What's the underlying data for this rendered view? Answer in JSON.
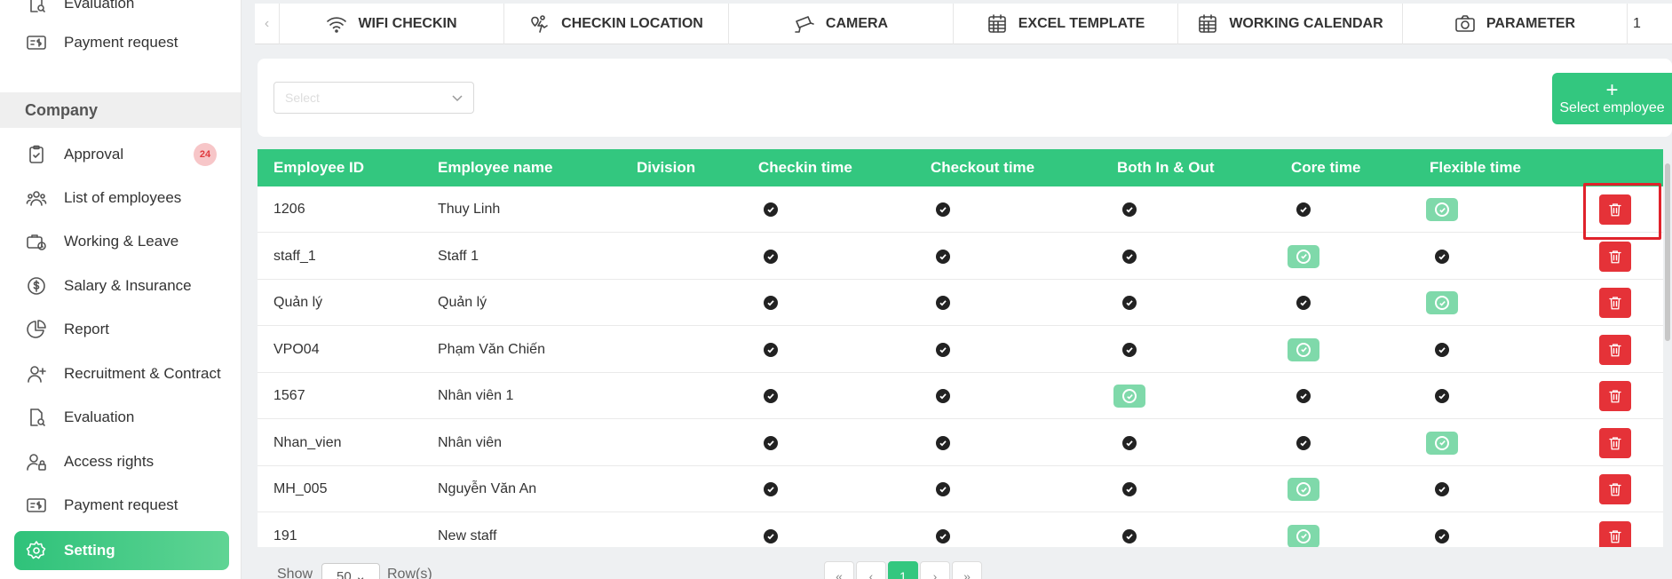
{
  "sidebar": {
    "top_items": [
      {
        "label": "Evaluation",
        "icon": "evaluation-icon"
      },
      {
        "label": "Payment request",
        "icon": "payment-icon"
      }
    ],
    "section_title": "Company",
    "items": [
      {
        "label": "Approval",
        "icon": "clipboard-check-icon",
        "badge": "24"
      },
      {
        "label": "List of employees",
        "icon": "users-icon"
      },
      {
        "label": "Working & Leave",
        "icon": "briefcase-clock-icon"
      },
      {
        "label": "Salary & Insurance",
        "icon": "dollar-circle-icon"
      },
      {
        "label": "Report",
        "icon": "pie-chart-icon"
      },
      {
        "label": "Recruitment & Contract",
        "icon": "user-plus-icon"
      },
      {
        "label": "Evaluation",
        "icon": "evaluation-icon"
      },
      {
        "label": "Access rights",
        "icon": "user-lock-icon"
      },
      {
        "label": "Payment request",
        "icon": "payment-icon"
      },
      {
        "label": "Setting",
        "icon": "gear-icon",
        "active": true
      }
    ]
  },
  "tabs": [
    {
      "label": "WIFI CHECKIN",
      "icon": "wifi-icon"
    },
    {
      "label": "CHECKIN LOCATION",
      "icon": "location-person-icon"
    },
    {
      "label": "CAMERA",
      "icon": "camera-cctv-icon"
    },
    {
      "label": "EXCEL TEMPLATE",
      "icon": "calendar-grid-icon"
    },
    {
      "label": "WORKING CALENDAR",
      "icon": "calendar-grid-icon"
    },
    {
      "label": "PARAMETER",
      "icon": "camera-icon"
    }
  ],
  "tabs_more": "1",
  "filter": {
    "select_placeholder": "Select",
    "add_button_label": "Select employee"
  },
  "table": {
    "columns": [
      "Employee ID",
      "Employee name",
      "Division",
      "Checkin time",
      "Checkout time",
      "Both In & Out",
      "Core time",
      "Flexible time"
    ],
    "rows": [
      {
        "id": "1206",
        "name": "Thuy Linh",
        "division": "",
        "flags": [
          "check",
          "check",
          "check",
          "check",
          "pill"
        ]
      },
      {
        "id": "staff_1",
        "name": "Staff 1",
        "division": "",
        "flags": [
          "check",
          "check",
          "check",
          "pill",
          "check"
        ]
      },
      {
        "id": "Quản lý",
        "name": "Quản lý",
        "division": "",
        "flags": [
          "check",
          "check",
          "check",
          "check",
          "pill"
        ]
      },
      {
        "id": "VPO04",
        "name": "Phạm Văn Chiến",
        "division": "",
        "flags": [
          "check",
          "check",
          "check",
          "pill",
          "check"
        ]
      },
      {
        "id": "1567",
        "name": "Nhân viên 1",
        "division": "",
        "flags": [
          "check",
          "check",
          "pill",
          "check",
          "check"
        ]
      },
      {
        "id": "Nhan_vien",
        "name": "Nhân viên",
        "division": "",
        "flags": [
          "check",
          "check",
          "check",
          "check",
          "pill"
        ]
      },
      {
        "id": "MH_005",
        "name": "Nguyễn Văn An",
        "division": "",
        "flags": [
          "check",
          "check",
          "check",
          "pill",
          "check"
        ]
      },
      {
        "id": "191",
        "name": "New staff",
        "division": "",
        "flags": [
          "check",
          "check",
          "check",
          "pill",
          "check"
        ]
      }
    ]
  },
  "footer": {
    "show_label": "Show",
    "page_size": "50",
    "rows_label": "Row(s)",
    "current_page": "1"
  },
  "colors": {
    "accent": "#33c77f",
    "danger": "#e53238",
    "highlight": "#e0222b"
  }
}
